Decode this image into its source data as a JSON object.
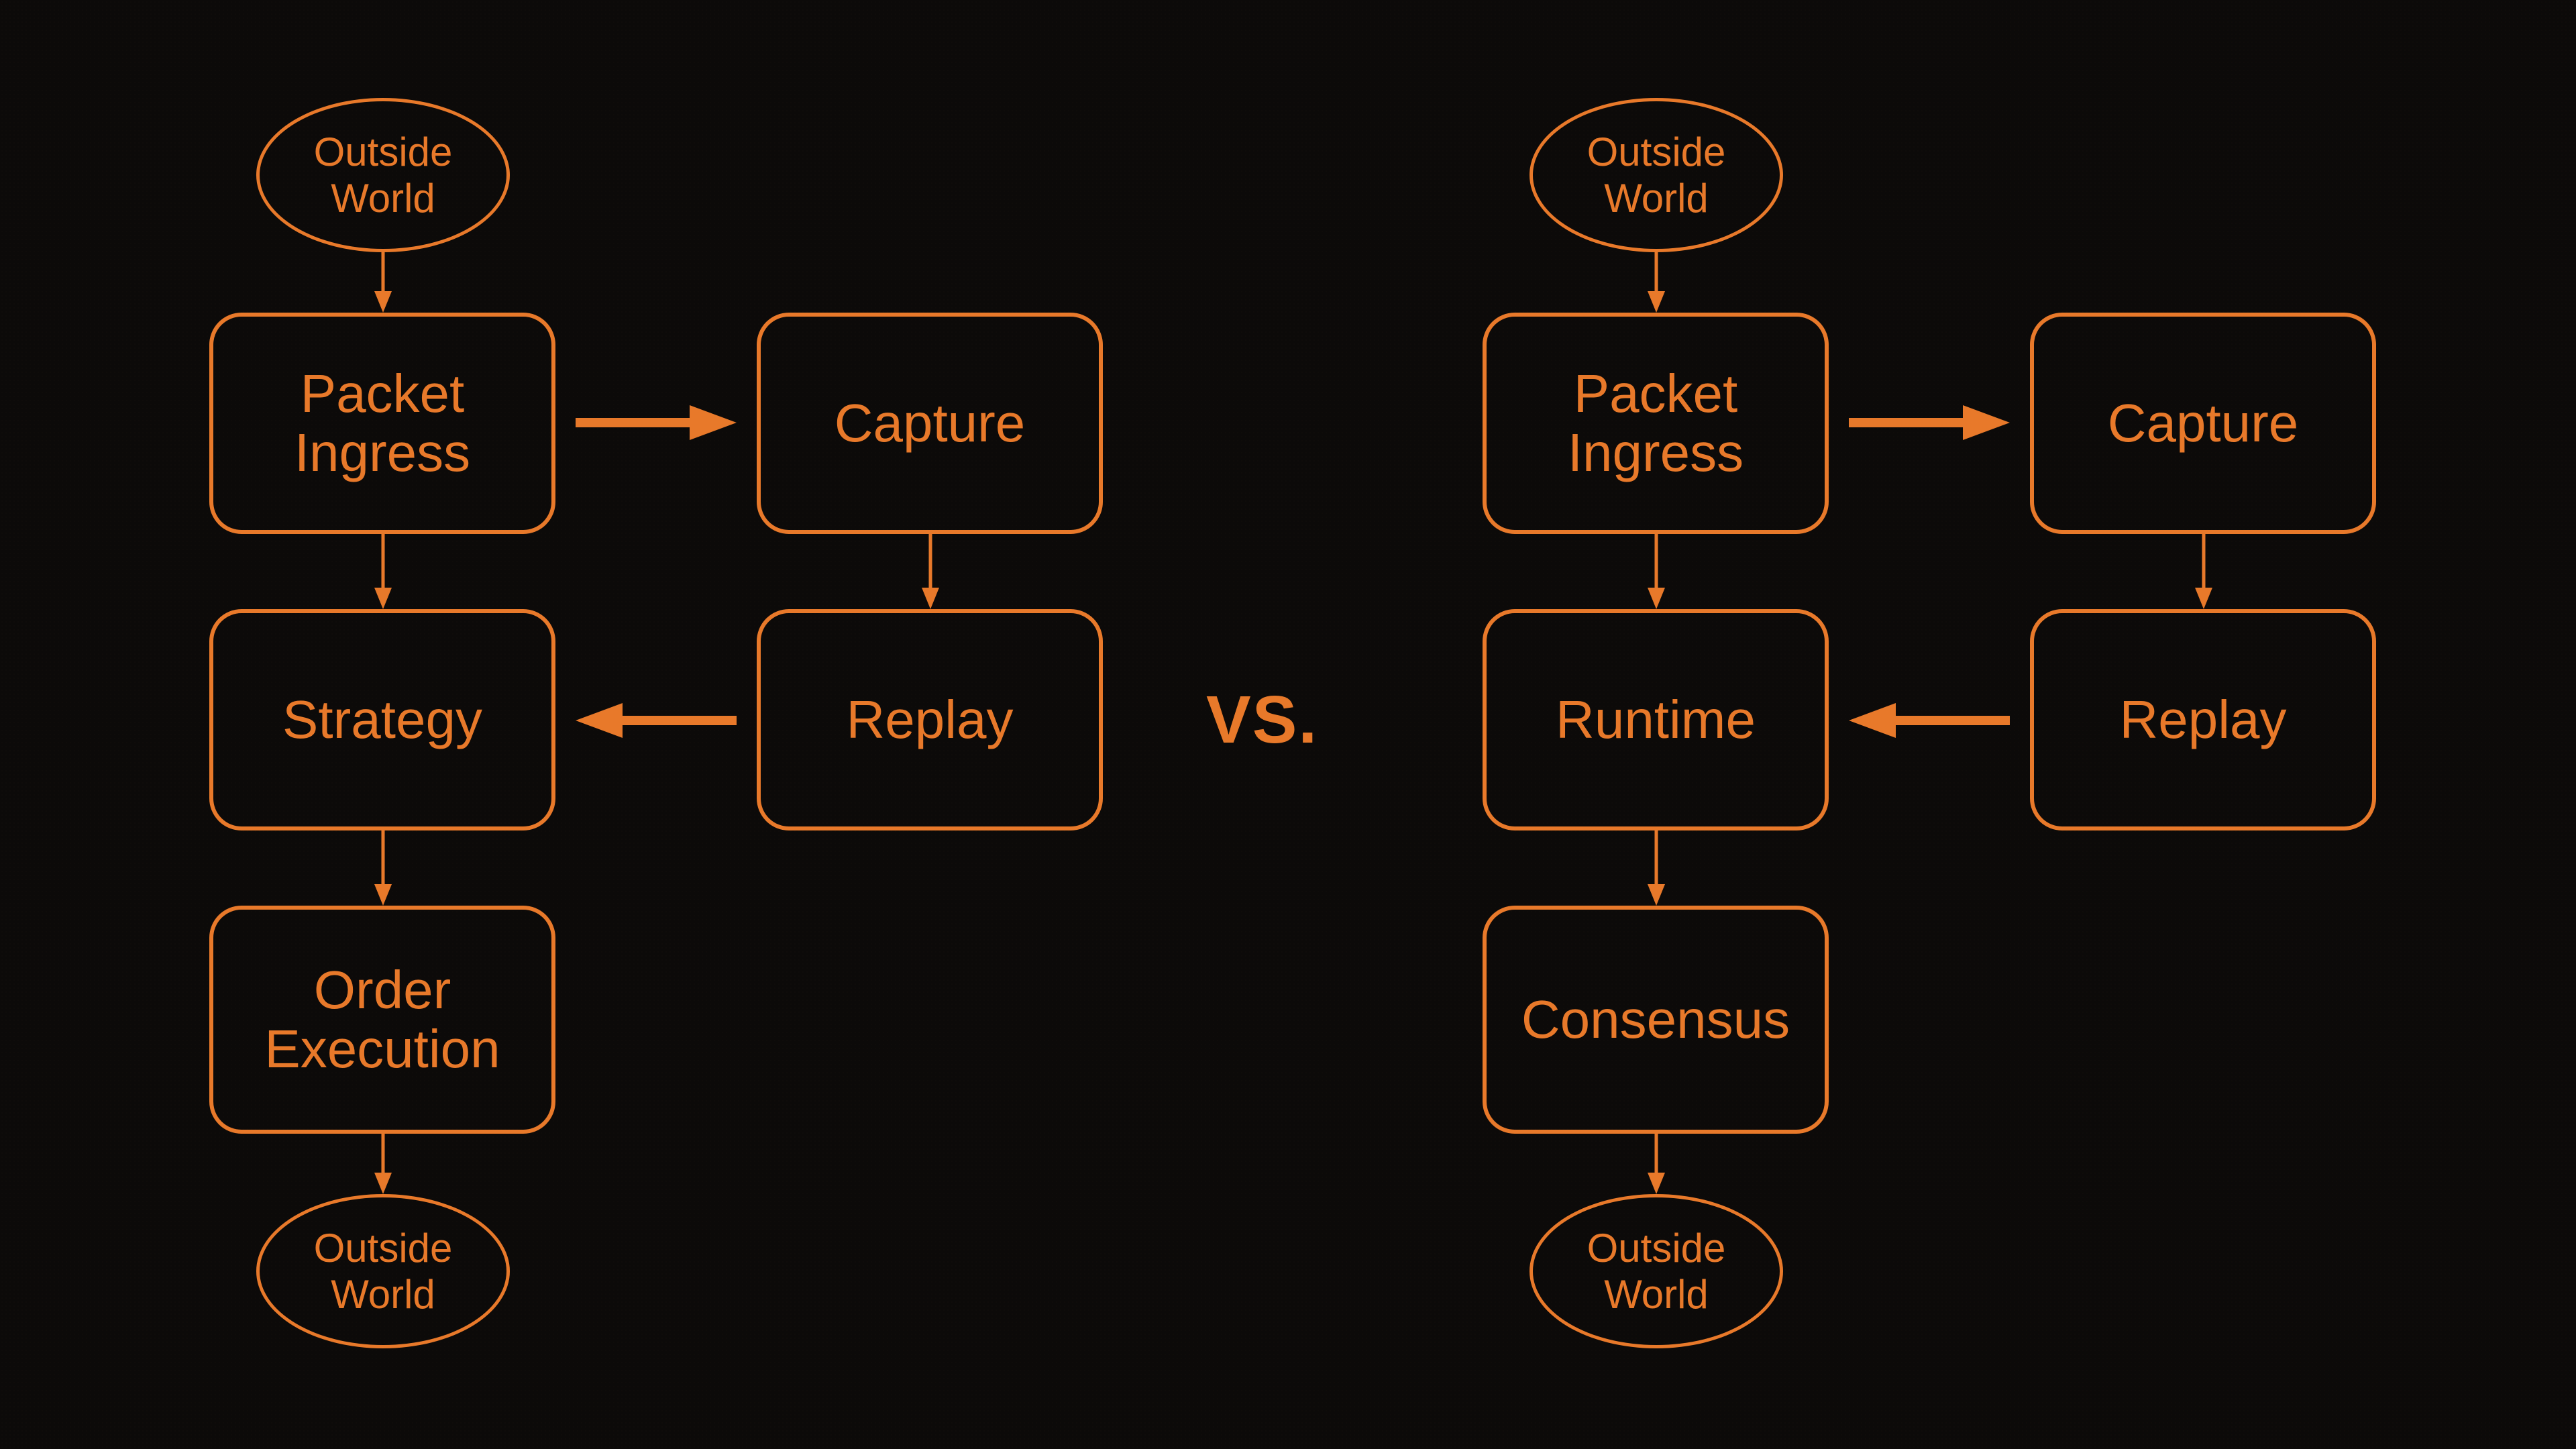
{
  "colors": {
    "accent": "#e8792a",
    "background": "#0c0a09"
  },
  "vs_label": "VS.",
  "left": {
    "outside_top": "Outside\nWorld",
    "packet_ingress": "Packet\nIngress",
    "capture": "Capture",
    "strategy": "Strategy",
    "replay": "Replay",
    "order_execution": "Order\nExecution",
    "outside_bottom": "Outside\nWorld"
  },
  "right": {
    "outside_top": "Outside\nWorld",
    "packet_ingress": "Packet\nIngress",
    "capture": "Capture",
    "runtime": "Runtime",
    "replay": "Replay",
    "consensus": "Consensus",
    "outside_bottom": "Outside\nWorld"
  }
}
